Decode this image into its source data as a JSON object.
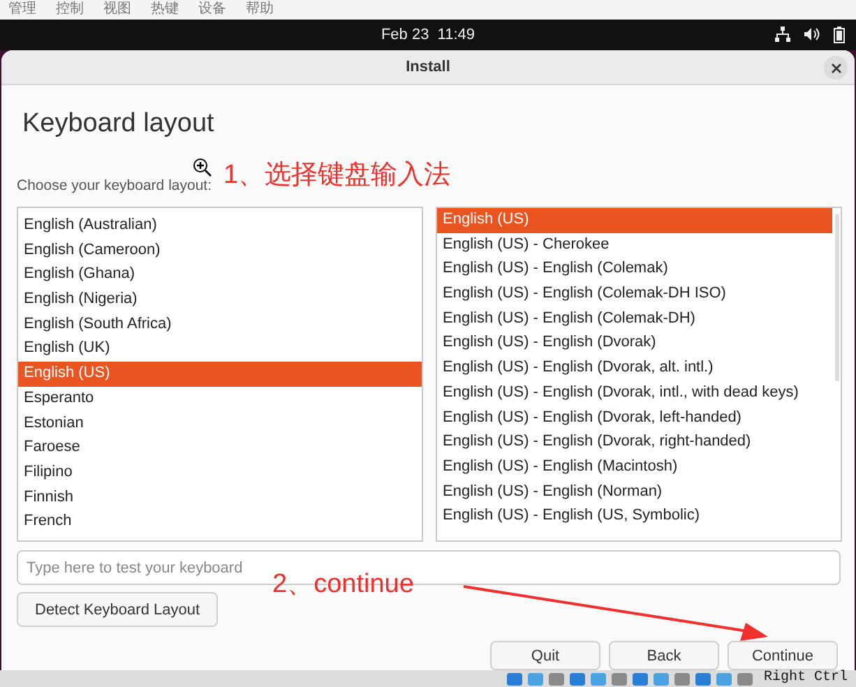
{
  "host_menu": [
    "管理",
    "控制",
    "视图",
    "热键",
    "设备",
    "帮助"
  ],
  "top_bar": {
    "clock": "Feb 23  11:49"
  },
  "window": {
    "title": "Install"
  },
  "heading": "Keyboard layout",
  "layout_label": "Choose your keyboard layout:",
  "layouts": [
    {
      "label": "English (Australian)",
      "selected": false
    },
    {
      "label": "English (Cameroon)",
      "selected": false
    },
    {
      "label": "English (Ghana)",
      "selected": false
    },
    {
      "label": "English (Nigeria)",
      "selected": false
    },
    {
      "label": "English (South Africa)",
      "selected": false
    },
    {
      "label": "English (UK)",
      "selected": false
    },
    {
      "label": "English (US)",
      "selected": true
    },
    {
      "label": "Esperanto",
      "selected": false
    },
    {
      "label": "Estonian",
      "selected": false
    },
    {
      "label": "Faroese",
      "selected": false
    },
    {
      "label": "Filipino",
      "selected": false
    },
    {
      "label": "Finnish",
      "selected": false
    },
    {
      "label": "French",
      "selected": false
    }
  ],
  "variants": [
    {
      "label": "English (US)",
      "selected": true
    },
    {
      "label": "English (US) - Cherokee",
      "selected": false
    },
    {
      "label": "English (US) - English (Colemak)",
      "selected": false
    },
    {
      "label": "English (US) - English (Colemak-DH ISO)",
      "selected": false
    },
    {
      "label": "English (US) - English (Colemak-DH)",
      "selected": false
    },
    {
      "label": "English (US) - English (Dvorak)",
      "selected": false
    },
    {
      "label": "English (US) - English (Dvorak, alt. intl.)",
      "selected": false
    },
    {
      "label": "English (US) - English (Dvorak, intl., with dead keys)",
      "selected": false
    },
    {
      "label": "English (US) - English (Dvorak, left-handed)",
      "selected": false
    },
    {
      "label": "English (US) - English (Dvorak, right-handed)",
      "selected": false
    },
    {
      "label": "English (US) - English (Macintosh)",
      "selected": false
    },
    {
      "label": "English (US) - English (Norman)",
      "selected": false
    },
    {
      "label": "English (US) - English (US, Symbolic)",
      "selected": false
    }
  ],
  "test_field": {
    "placeholder": "Type here to test your keyboard"
  },
  "detect_button": "Detect Keyboard Layout",
  "buttons": [
    "Quit",
    "Back",
    "Continue"
  ],
  "annotations": [
    "1、选择键盘输入法",
    "2、continue"
  ],
  "status_bar": {
    "host_key": "Right Ctrl"
  }
}
